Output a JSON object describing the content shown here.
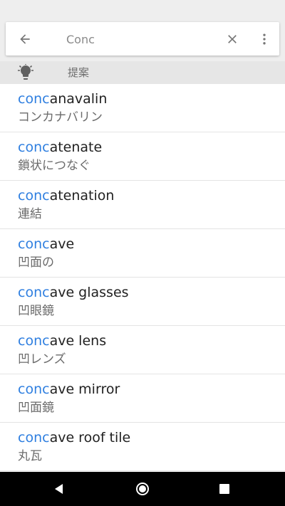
{
  "search": {
    "value": "Conc",
    "placeholder": ""
  },
  "icons": {
    "back": "arrow-back-icon",
    "clear": "close-icon",
    "more": "more-vert-icon",
    "suggest": "lightbulb-icon",
    "nav_back": "triangle-back-icon",
    "nav_home": "circle-home-icon",
    "nav_recents": "square-recents-icon"
  },
  "colors": {
    "highlight": "#2f7fe0",
    "header_bg": "#e6e6e6",
    "navbar_bg": "#000000"
  },
  "suggestions_header": {
    "label": "提案"
  },
  "results": [
    {
      "prefix": "conc",
      "rest": "anavalin",
      "translation": "コンカナバリン"
    },
    {
      "prefix": "conc",
      "rest": "atenate",
      "translation": "鎖状につなぐ"
    },
    {
      "prefix": "conc",
      "rest": "atenation",
      "translation": "連結"
    },
    {
      "prefix": "conc",
      "rest": "ave",
      "translation": "凹面の"
    },
    {
      "prefix": "conc",
      "rest": "ave glasses",
      "translation": "凹眼鏡"
    },
    {
      "prefix": "conc",
      "rest": "ave lens",
      "translation": "凹レンズ"
    },
    {
      "prefix": "conc",
      "rest": "ave mirror",
      "translation": "凹面鏡"
    },
    {
      "prefix": "conc",
      "rest": "ave roof tile",
      "translation": "丸瓦"
    }
  ]
}
